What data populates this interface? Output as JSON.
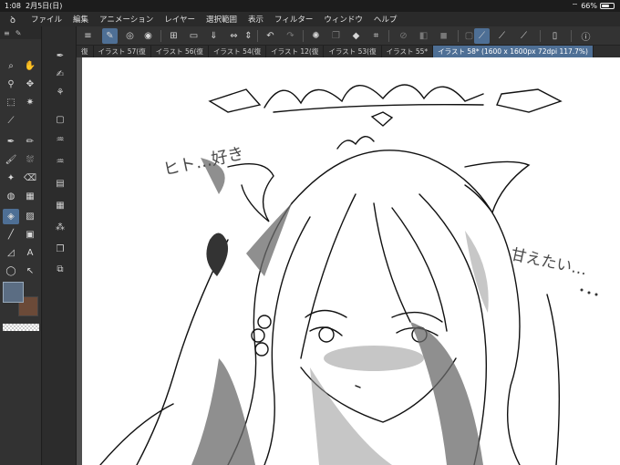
{
  "status": {
    "time": "1:08",
    "date": "2月5日(日)",
    "battery": "66%",
    "battery_level": 0.66
  },
  "menu": {
    "items": [
      "ファイル",
      "編集",
      "アニメーション",
      "レイヤー",
      "選択範囲",
      "表示",
      "フィルター",
      "ウィンドウ",
      "ヘルプ"
    ]
  },
  "doc_tabs": [
    {
      "label": "イラスト 57(復",
      "active": false
    },
    {
      "label": "イラスト 56(復",
      "active": false
    },
    {
      "label": "イラスト 54(復",
      "active": false
    },
    {
      "label": "イラスト 12(復",
      "active": false
    },
    {
      "label": "イラスト 53(復",
      "active": false
    },
    {
      "label": "イラスト 55*",
      "active": false
    },
    {
      "label": "イラスト 58* (1600 x 1600px 72dpi 117.7%)",
      "active": true
    }
  ],
  "canvas_text": {
    "left_note": "ヒト…好き",
    "right_note": "甘えたい…"
  },
  "colors": {
    "accent": "#4e6f95",
    "main_color": "#5b6d83",
    "sub_color": "#6b4a38"
  }
}
